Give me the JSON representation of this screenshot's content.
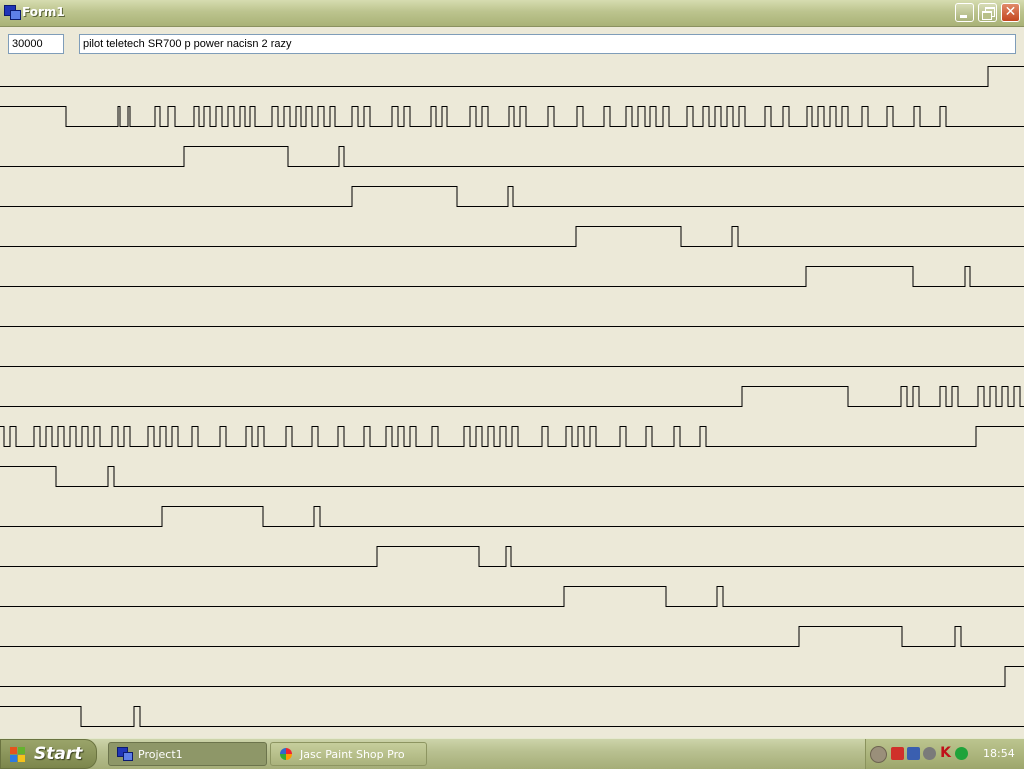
{
  "window": {
    "title": "Form1",
    "icon": "form-app-icon"
  },
  "controls": {
    "minimize_icon": "minimize-icon",
    "maximize_icon": "restore-icon",
    "close_icon": "close-icon"
  },
  "inputs": {
    "interval_value": "30000",
    "description_value": "pilot teletech SR700 p power nacisn 2 razy"
  },
  "plot": {
    "line_color": "#000000",
    "background": "#ECE9D8",
    "traces": [
      "L0 988 U988 1024",
      "H0 66 L66 118 U118 120 L120 128 U128 130 L130 155 U155 160 L160 168 U168 175 L175 194 U194 199 L199 204 U204 210 L210 216 U216 222 L222 228 U228 234 L234 240 U240 245 L245 250 U250 255 L255 272 U272 278 L278 284 U284 290 L290 296 U296 301 L301 306 U306 312 L312 318 U318 324 L324 330 U330 335 L335 352 U352 358 L358 364 U364 370 L370 392 U392 398 L398 404 U404 410 L410 431 U431 436 L436 442 U442 447 L447 470 U470 476 L476 482 U482 488 L488 509 U509 514 L514 520 U520 526 L526 548 U548 554 L554 577 U577 583 L583 604 U604 610 L610 626 U626 632 L632 638 U638 645 L645 650 U650 656 L656 663 U663 669 L669 687 U687 693 L693 703 U703 709 L709 715 U715 721 L721 727 U727 733 L733 739 U739 745 L745 765 U765 771 L771 783 U783 789 L789 807 U807 812 L812 818 U818 824 L824 830 U830 836 L836 842 U842 848 L848 862 U862 868 L868 887 U887 893 L893 914 U914 920 L920 940 U940 946 L946 1024",
      "L0 184 U184 288 L288 339 U339 344 L344 1024",
      "L0 352 U352 457 L457 508 U508 513 L513 1024",
      "L0 576 U576 681 L681 732 U732 738 L738 1024",
      "L0 806 U806 913 L913 965 U965 970 L970 1024",
      "L0 1024",
      "L0 1024",
      "L0 742 U742 848 L848 901 U901 907 L907 913 U913 919 L919 940 U940 946 L946 952 U952 958 L958 978 U978 984 L984 990 U990 996 L996 1002 U1002 1008 L1008 1014 U1014 1020 L1020 1024",
      "U0 4 L4 10 U10 16 L16 34 U34 40 L40 46 U46 52 L52 58 U58 64 L64 70 U70 76 L76 82 U82 88 L88 94 U94 100 L100 112 U112 118 L118 124 U124 130 L130 148 U148 154 L154 160 U160 166 L166 172 U172 178 L178 192 U192 198 L198 220 U220 226 L226 246 U246 252 L252 258 U258 264 L264 286 U286 292 L292 312 U312 318 L318 338 U338 344 L344 364 U364 370 L370 386 U386 392 L392 398 U398 404 L404 410 U410 416 L416 432 U432 438 L438 464 U464 470 L470 476 U476 482 L482 488 U488 494 L494 500 U500 506 L506 512 U512 518 L518 542 U542 548 L548 566 U566 572 L572 578 U578 584 L584 590 U590 596 L596 620 U620 626 L626 646 U646 652 L652 674 U674 680 L680 700 U700 706 L706 976 U976 1024",
      "H0 56 L56 108 U108 114 L114 1024",
      "L0 162 U162 263 L263 314 U314 320 L320 1024",
      "L0 377 U377 479 L479 506 U506 511 L511 1024",
      "L0 564 U564 666 L666 717 U717 723 L723 1024",
      "L0 799 U799 902 L902 955 U955 961 L961 1024",
      "L0 1005 U1005 1024",
      "H0 81 L81 134 U134 140 L140 1024"
    ]
  },
  "taskbar": {
    "start_label": "Start",
    "items": [
      {
        "label": "Project1",
        "icon": "form-app-icon"
      },
      {
        "label": "Jasc Paint Shop Pro",
        "icon": "paint-shop-pro-icon"
      }
    ],
    "clock": "18:54"
  }
}
